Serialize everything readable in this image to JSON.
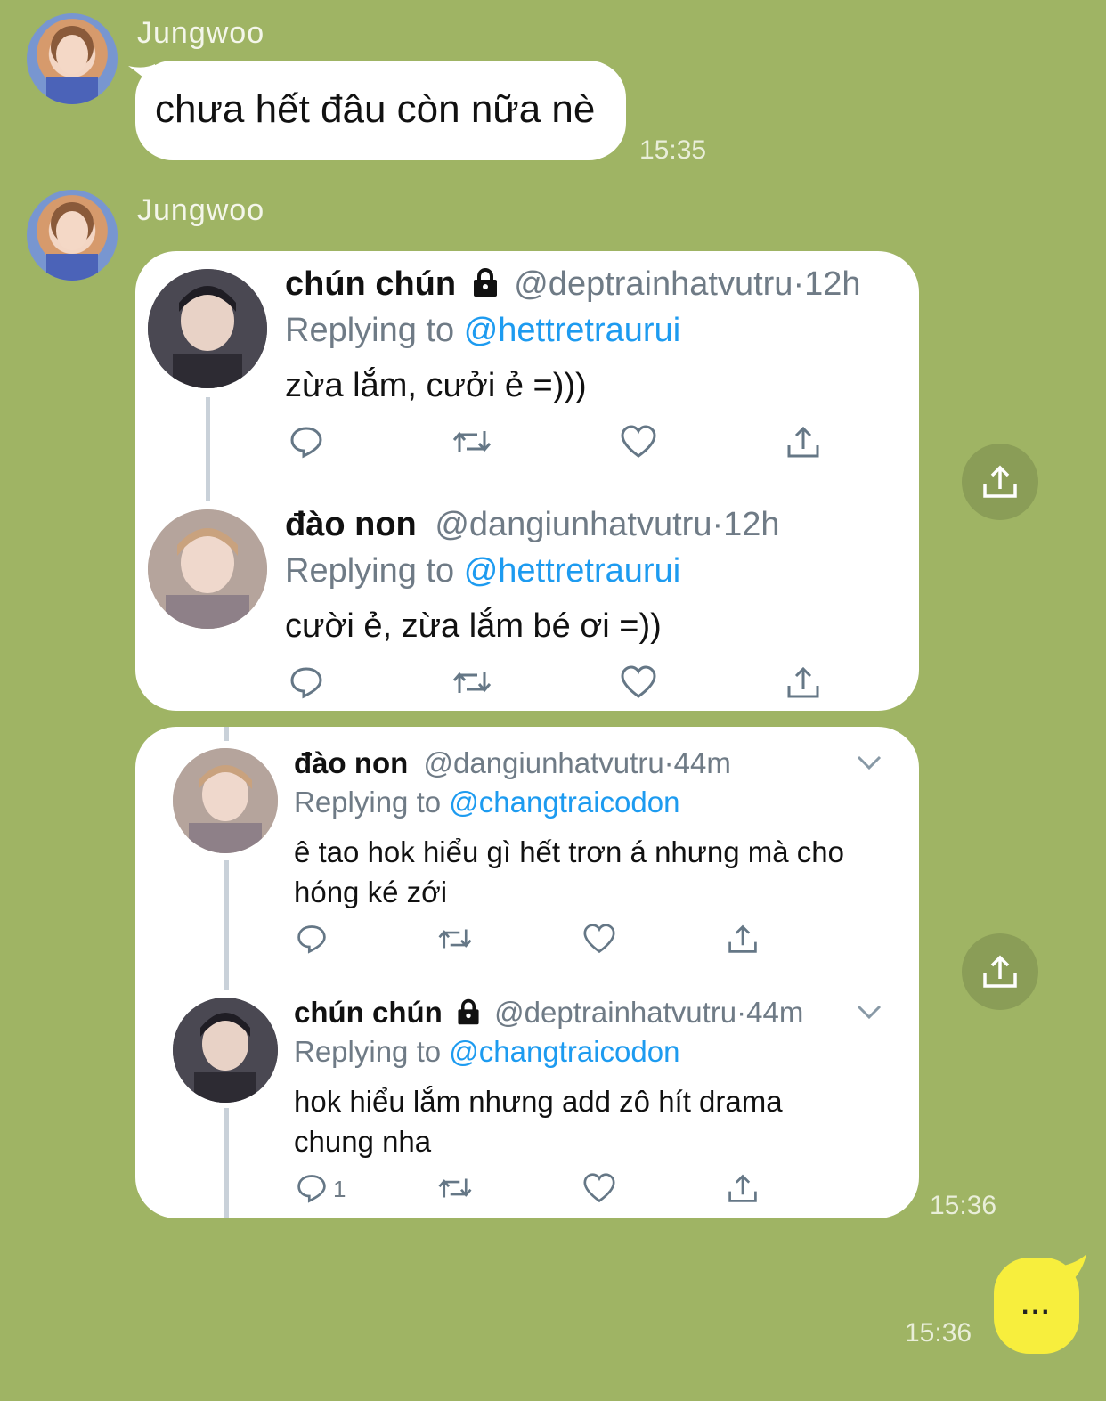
{
  "messages": [
    {
      "sender": "Jungwoo",
      "text": "chưa hết đâu còn nữa nè",
      "time": "15:35"
    },
    {
      "sender": "Jungwoo",
      "time": "15:36"
    }
  ],
  "card1": {
    "tweets": [
      {
        "name": "chún chún",
        "locked": true,
        "handle": "@deptrainhatvutru",
        "sep": "·",
        "age": "12h",
        "replying_prefix": "Replying to",
        "replying_to": "@hettretraurui",
        "text": "zừa lắm, cưởi ẻ =)))"
      },
      {
        "name": "đào non",
        "locked": false,
        "handle": "@dangiunhatvutru",
        "sep": "·",
        "age": "12h",
        "replying_prefix": "Replying to",
        "replying_to": "@hettretraurui",
        "text": "cười ẻ, zừa lắm bé ơi =))"
      }
    ]
  },
  "card2": {
    "tweets": [
      {
        "name": "đào non",
        "locked": false,
        "handle": "@dangiunhatvutru",
        "sep": "·",
        "age": "44m",
        "replying_prefix": "Replying to",
        "replying_to": "@changtraicodon",
        "text_line1": "ê tao hok hiểu gì hết trơn á nhưng mà cho",
        "text_line2": "hóng ké zới"
      },
      {
        "name": "chún chún",
        "locked": true,
        "handle": "@deptrainhatvutru",
        "sep": "·",
        "age": "44m",
        "replying_prefix": "Replying to",
        "replying_to": "@changtraicodon",
        "text_line1": "hok hiểu lắm nhưng add zô hít drama",
        "text_line2": "chung nha",
        "reply_count": "1"
      }
    ]
  },
  "own_message": {
    "time": "15:36",
    "text": "..."
  },
  "icons": {
    "reply": "reply-icon",
    "retweet": "retweet-icon",
    "like": "heart-icon",
    "share": "share-icon",
    "lock": "lock-icon",
    "chevron": "chevron-down-icon"
  },
  "colors": {
    "background": "#9fb464",
    "mention": "#1d9bf0",
    "own_bubble": "#f7ee3d"
  }
}
